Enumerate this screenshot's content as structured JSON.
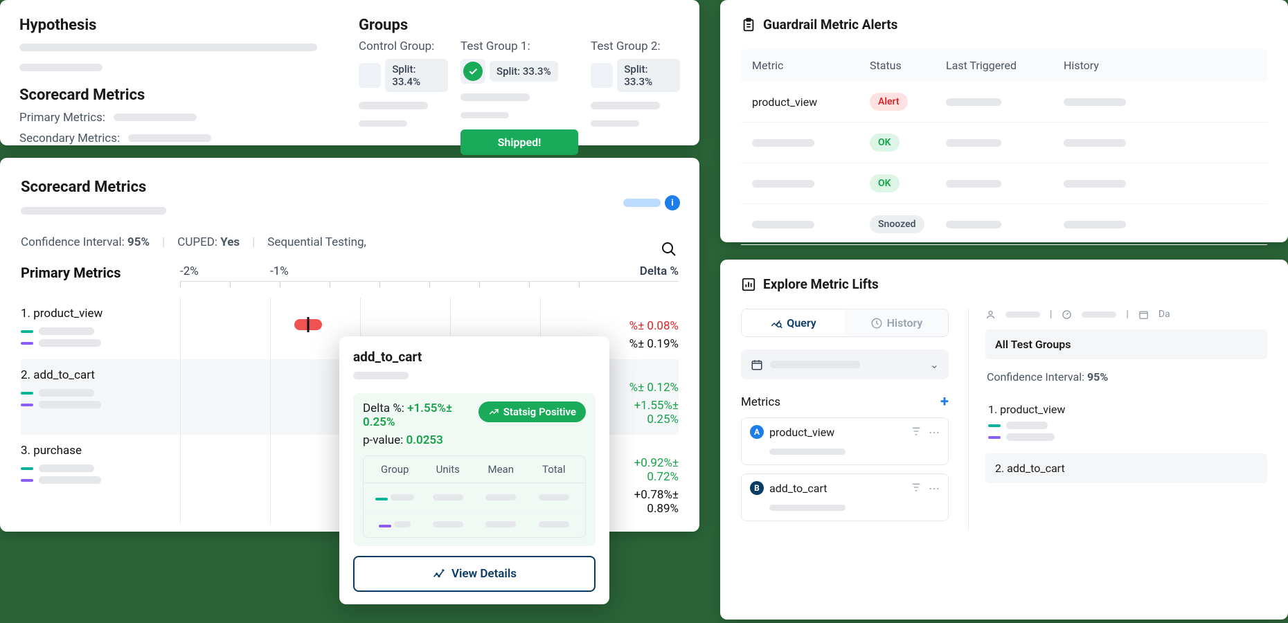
{
  "hypothesis": {
    "title": "Hypothesis"
  },
  "scorecard_metrics_label": "Scorecard Metrics",
  "primary_metrics_label": "Primary Metrics:",
  "secondary_metrics_label": "Secondary Metrics:",
  "groups": {
    "title": "Groups",
    "items": [
      {
        "label": "Control Group:",
        "split": "Split: 33.4%",
        "check": false
      },
      {
        "label": "Test Group 1:",
        "split": "Split: 33.3%",
        "check": true,
        "shipped": "Shipped!"
      },
      {
        "label": "Test Group 2:",
        "split": "Split: 33.3%",
        "check": false
      }
    ]
  },
  "scorecard": {
    "title": "Scorecard Metrics",
    "stats": {
      "ci_label": "Confidence Interval:",
      "ci_value": "95%",
      "cuped_label": "CUPED:",
      "cuped_value": "Yes",
      "seq_label": "Sequential Testing,"
    },
    "header": {
      "primary": "Primary Metrics",
      "m2": "-2%",
      "m1": "-1%",
      "delta": "Delta %"
    },
    "rows": [
      {
        "n": "1. product_view",
        "deltas": [
          "%± 0.08%",
          "%± 0.19%"
        ],
        "classes": [
          "dv-red",
          "dv-grey"
        ]
      },
      {
        "n": "2. add_to_cart",
        "deltas": [
          "%± 0.12%",
          "+1.55%± 0.25%"
        ],
        "classes": [
          "dv-green",
          "dv-green"
        ]
      },
      {
        "n": "3. purchase",
        "deltas": [
          "+0.92%± 0.72%",
          "+0.78%± 0.89%"
        ],
        "classes": [
          "dv-green",
          "dv-grey"
        ]
      }
    ]
  },
  "tooltip": {
    "metric": "add_to_cart",
    "delta_label": "Delta %:",
    "delta_value": "+1.55%± 0.25%",
    "pval_label": "p-value:",
    "pval_value": "0.0253",
    "pill": "Statsig Positive",
    "cols": {
      "g": "Group",
      "u": "Units",
      "m": "Mean",
      "t": "Total"
    },
    "view_details": "View Details"
  },
  "guardrail": {
    "title": "Guardrail Metric Alerts",
    "cols": {
      "m": "Metric",
      "s": "Status",
      "lt": "Last Triggered",
      "h": "History"
    },
    "rows": [
      {
        "metric": "product_view",
        "status": "Alert",
        "cls": "b-alert"
      },
      {
        "metric": "",
        "status": "OK",
        "cls": "b-ok"
      },
      {
        "metric": "",
        "status": "OK",
        "cls": "b-ok"
      },
      {
        "metric": "",
        "status": "Snoozed",
        "cls": "b-snooze"
      }
    ]
  },
  "explore": {
    "title": "Explore Metric Lifts",
    "tabs": {
      "query": "Query",
      "history": "History"
    },
    "metrics_label": "Metrics",
    "items": [
      {
        "letter": "A",
        "name": "product_view"
      },
      {
        "letter": "B",
        "name": "add_to_cart"
      }
    ],
    "date_label": "Da",
    "all_groups": "All Test Groups",
    "ci_label": "Confidence Interval:",
    "ci_value": "95%",
    "rows": [
      {
        "n": "1. product_view"
      },
      {
        "n": "2. add_to_cart"
      }
    ]
  }
}
